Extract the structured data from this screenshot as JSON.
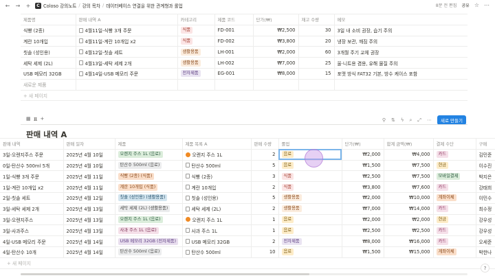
{
  "topbar": {
    "logo_letter": "C",
    "breadcrumbs": [
      "Coloso 강의노트",
      "강의 목차",
      "데이터베이스 연결을 위한 관계형과 롤업"
    ],
    "edited": "8분 전 편집",
    "share": "공유"
  },
  "products_table": {
    "headers": [
      "제품명",
      "판매 내역 A",
      "카테고리",
      "제품 코드",
      "단가(₩)",
      "재고 수량",
      "메모"
    ],
    "rows": [
      {
        "name": "식빵 (2종)",
        "sale": "4월11일-식빵 3개 주문",
        "category": "식품",
        "cat_class": "t-food",
        "code": "FD-001",
        "price": "₩2,500",
        "stock": "30",
        "memo": "3일 내 소비 권장, 습기 주의"
      },
      {
        "name": "계란 10개입",
        "sale": "4월11일-계란 10개입 x2",
        "category": "식품",
        "cat_class": "t-food",
        "code": "FD-002",
        "price": "₩3,800",
        "stock": "20",
        "memo": "냉장 보관, 깨짐 주의"
      },
      {
        "name": "칫솔 (성인용)",
        "sale": "4월12일-칫솔 세트",
        "category": "생활용품",
        "cat_class": "t-daily",
        "code": "LH-001",
        "price": "₩2,000",
        "stock": "60",
        "memo": "3개월 주기 교체 권장"
      },
      {
        "name": "세탁 세제 (2L)",
        "sale": "4월13일-세탁 세제 2개",
        "category": "생활용품",
        "cat_class": "t-daily",
        "code": "LH-002",
        "price": "₩7,000",
        "stock": "25",
        "memo": "울·니트용 겸용, 유해 물질 주의"
      },
      {
        "name": "USB 메모리 32GB",
        "sale": "4월14일-USB 메모리 주문",
        "category": "전자제품",
        "cat_class": "t-elec",
        "code": "EG-001",
        "price": "₩8,000",
        "stock": "15",
        "memo": "포맷 방식 FAT32 기본, 방수 케이스 포함"
      }
    ],
    "new_row_label": "새로운 제품",
    "add_page": "+ 새 페이지"
  },
  "viewbar": {
    "view_label": "표",
    "new_button": "새로 만들기"
  },
  "sales_section": {
    "title": "판매 내역 A",
    "headers": [
      "판매 내역",
      "판매 일자",
      "제품",
      "제품 목록 A",
      "판매 수량",
      "롤업",
      "단가(₩)",
      "합계 금액(₩)",
      "결제 수단",
      "구매"
    ],
    "rows": [
      {
        "name": "3일-오렌지주스 주문",
        "date": "2025년 4월 10일",
        "product": "오렌지 주스 1L (음료)",
        "prod_class": "t-p-green",
        "plist": "오렌지 주스 1L",
        "plist_icon": "fruit",
        "qty": "2",
        "rollup": "음료",
        "roll_class": "t-drink",
        "price": "₩2,000",
        "total": "₩4,000",
        "pay": "카드",
        "pay_class": "t-card",
        "buyer": "김민준"
      },
      {
        "name": "0일-탄산수 500ml 5개",
        "date": "2025년 4월 10일",
        "product": "탄산수 500ml (음료)",
        "prod_class": "t-p-gray",
        "plist": "탄산수 500ml",
        "plist_icon": "doc",
        "qty": "5",
        "rollup": "음료",
        "roll_class": "t-drink",
        "price": "₩1,500",
        "total": "₩7,500",
        "pay": "현금",
        "pay_class": "t-cash",
        "buyer": "이수진"
      },
      {
        "name": "1일-식빵 3개 주문",
        "date": "2025년 4월 11일",
        "product": "식빵 (2종) (식품)",
        "prod_class": "t-p-orange",
        "plist": "식빵 (2종)",
        "plist_icon": "doc",
        "qty": "3",
        "rollup": "식품",
        "roll_class": "t-food",
        "price": "₩2,500",
        "total": "₩7,500",
        "pay": "모바일결제",
        "pay_class": "t-mobile",
        "buyer": "박지은"
      },
      {
        "name": "1일-계란 10개입 x2",
        "date": "2025년 4월 11일",
        "product": "계란 10개입 (식품)",
        "prod_class": "t-p-orange",
        "plist": "계란 10개입",
        "plist_icon": "doc",
        "qty": "2",
        "rollup": "식품",
        "roll_class": "t-food",
        "price": "₩3,800",
        "total": "₩7,600",
        "pay": "카드",
        "pay_class": "t-card",
        "buyer": "강태희"
      },
      {
        "name": "2일-칫솔 세트",
        "date": "2025년 4월 12일",
        "product": "칫솔 (성인용) (생활용품)",
        "prod_class": "t-p-blue",
        "plist": "칫솔 (성인용)",
        "plist_icon": "doc",
        "qty": "5",
        "rollup": "생활용품",
        "roll_class": "t-daily",
        "price": "₩2,000",
        "total": "₩10,000",
        "pay": "계좌이체",
        "pay_class": "t-transfer",
        "buyer": "이민수"
      },
      {
        "name": "3일-세탁 세제 2개",
        "date": "2025년 4월 13일",
        "product": "세탁 세제 (2L) (생활용품)",
        "prod_class": "t-p-gray",
        "plist": "세탁 세제 (2L)",
        "plist_icon": "doc",
        "qty": "2",
        "rollup": "생활용품",
        "roll_class": "t-daily",
        "price": "₩7,000",
        "total": "₩14,000",
        "pay": "카드",
        "pay_class": "t-card",
        "buyer": "최수정"
      },
      {
        "name": "3일-오렌지주스",
        "date": "2025년 4월 13일",
        "product": "오렌지 주스 1L (음료)",
        "prod_class": "t-p-green",
        "plist": "오렌지 주스 1L",
        "plist_icon": "fruit",
        "qty": "1",
        "rollup": "음료",
        "roll_class": "t-drink",
        "price": "₩2,000",
        "total": "₩2,000",
        "pay": "현금",
        "pay_class": "t-cash",
        "buyer": "강우성"
      },
      {
        "name": "3일-사과주스",
        "date": "2025년 4월 13일",
        "product": "사과 주스 1L (음료)",
        "prod_class": "t-p-pink",
        "plist": "사과 주스 1L",
        "plist_icon": "doc",
        "qty": "1",
        "rollup": "음료",
        "roll_class": "t-drink",
        "price": "₩2,500",
        "total": "₩2,500",
        "pay": "카드",
        "pay_class": "t-card",
        "buyer": "강우성"
      },
      {
        "name": "4일-USB 메모리 주문",
        "date": "2025년 4월 14일",
        "product": "USB 메모리 32GB (전자제품)",
        "prod_class": "t-p-purple",
        "plist": "USB 메모리 32GB",
        "plist_icon": "doc",
        "qty": "2",
        "rollup": "전자제품",
        "roll_class": "t-elec",
        "price": "₩8,000",
        "total": "₩16,000",
        "pay": "카드",
        "pay_class": "t-card",
        "buyer": "오세준"
      },
      {
        "name": "4일-탄산수 10개",
        "date": "2025년 4월 14일",
        "product": "탄산수 500ml (음료)",
        "prod_class": "t-p-gray",
        "plist": "탄산수 500ml",
        "plist_icon": "doc",
        "qty": "10",
        "rollup": "음료",
        "roll_class": "t-drink",
        "price": "₩1,500",
        "total": "₩15,000",
        "pay": "계좌이체",
        "pay_class": "t-transfer",
        "buyer": "박한나"
      }
    ],
    "add_page": "+ 새 페이지"
  }
}
